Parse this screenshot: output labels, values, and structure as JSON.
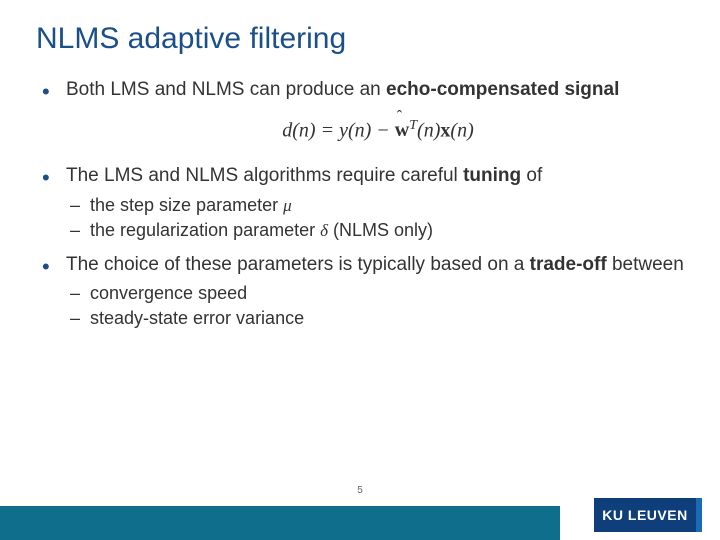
{
  "title": "NLMS adaptive filtering",
  "bullets": {
    "b1_pre": "Both LMS and NLMS can produce an ",
    "b1_bold": "echo-compensated signal",
    "formula": "d(n) = y(n) − ŵᵀ(n)x(n)",
    "b2_pre": "The LMS and NLMS algorithms require careful ",
    "b2_bold": "tuning",
    "b2_post": " of",
    "b2_sub1": "the step size parameter ",
    "b2_sym1": "μ",
    "b2_sub2": "the regularization parameter ",
    "b2_sym2": "δ",
    "b2_sub2_post": " (NLMS only)",
    "b3_pre": "The choice of these parameters is typically based on a ",
    "b3_bold": "trade-off",
    "b3_post": " between",
    "b3_sub1": "convergence speed",
    "b3_sub2": "steady-state error variance"
  },
  "page_number": "5",
  "logo_text": "KU LEUVEN"
}
